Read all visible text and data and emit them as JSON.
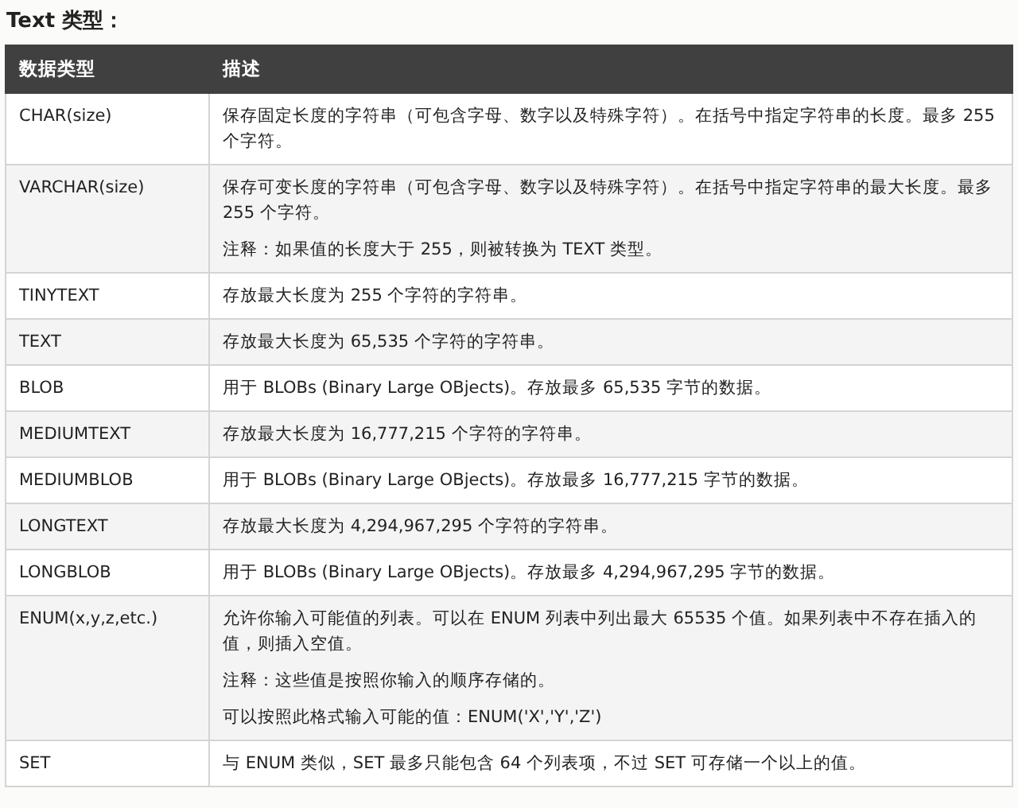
{
  "heading": "Text 类型：",
  "table": {
    "columns": [
      "数据类型",
      "描述"
    ],
    "rows": [
      {
        "type": "CHAR(size)",
        "description": [
          "保存固定长度的字符串（可包含字母、数字以及特殊字符）。在括号中指定字符串的长度。最多 255 个字符。"
        ]
      },
      {
        "type": "VARCHAR(size)",
        "description": [
          "保存可变长度的字符串（可包含字母、数字以及特殊字符）。在括号中指定字符串的最大长度。最多 255 个字符。",
          "注释：如果值的长度大于 255，则被转换为 TEXT 类型。"
        ]
      },
      {
        "type": "TINYTEXT",
        "description": [
          "存放最大长度为 255 个字符的字符串。"
        ]
      },
      {
        "type": "TEXT",
        "description": [
          "存放最大长度为 65,535 个字符的字符串。"
        ]
      },
      {
        "type": "BLOB",
        "description": [
          "用于 BLOBs (Binary Large OBjects)。存放最多 65,535 字节的数据。"
        ]
      },
      {
        "type": "MEDIUMTEXT",
        "description": [
          "存放最大长度为 16,777,215 个字符的字符串。"
        ]
      },
      {
        "type": "MEDIUMBLOB",
        "description": [
          "用于 BLOBs (Binary Large OBjects)。存放最多 16,777,215 字节的数据。"
        ]
      },
      {
        "type": "LONGTEXT",
        "description": [
          "存放最大长度为 4,294,967,295 个字符的字符串。"
        ]
      },
      {
        "type": "LONGBLOB",
        "description": [
          "用于 BLOBs (Binary Large OBjects)。存放最多 4,294,967,295 字节的数据。"
        ]
      },
      {
        "type": "ENUM(x,y,z,etc.)",
        "description": [
          "允许你输入可能值的列表。可以在 ENUM 列表中列出最大 65535 个值。如果列表中不存在插入的值，则插入空值。",
          "注释：这些值是按照你输入的顺序存储的。",
          "可以按照此格式输入可能的值：ENUM('X','Y','Z')"
        ]
      },
      {
        "type": "SET",
        "description": [
          "与 ENUM 类似，SET 最多只能包含 64 个列表项，不过 SET 可存储一个以上的值。"
        ]
      }
    ]
  }
}
